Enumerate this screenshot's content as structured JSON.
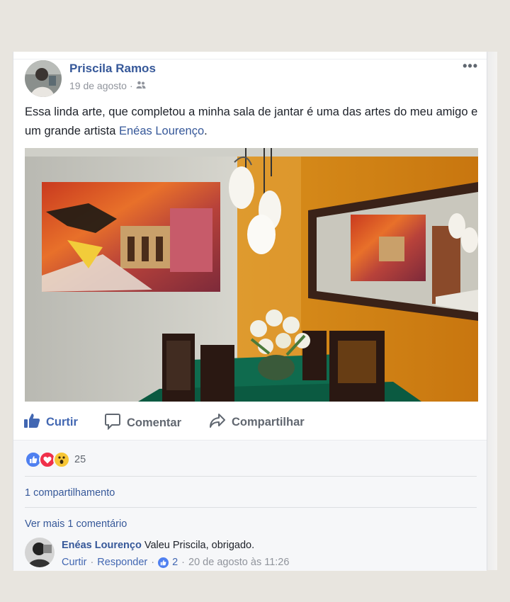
{
  "post": {
    "author": "Priscila Ramos",
    "date": "19 de agosto",
    "privacy_icon": "friends-icon",
    "more_label": "•••",
    "text_before": "Essa linda arte, que completou a minha sala de jantar é uma das artes do meu amigo e um grande artista ",
    "text_link": "Enéas Lourenço",
    "text_after": "."
  },
  "actions": {
    "like": "Curtir",
    "comment": "Comentar",
    "share": "Compartilhar"
  },
  "feedback": {
    "reactions": [
      "like-icon",
      "love-icon",
      "wow-icon"
    ],
    "reaction_count": "25",
    "shares": "1 compartilhamento",
    "more_comments": "Ver mais 1 comentário"
  },
  "comment": {
    "author": "Enéas Lourenço",
    "text": "Valeu Priscila, obrigado.",
    "like": "Curtir",
    "reply": "Responder",
    "like_count": "2",
    "timestamp": "20 de agosto às 11:26"
  },
  "colors": {
    "link": "#365899",
    "like_blue": "#4267b2",
    "background": "#e8e5df"
  }
}
